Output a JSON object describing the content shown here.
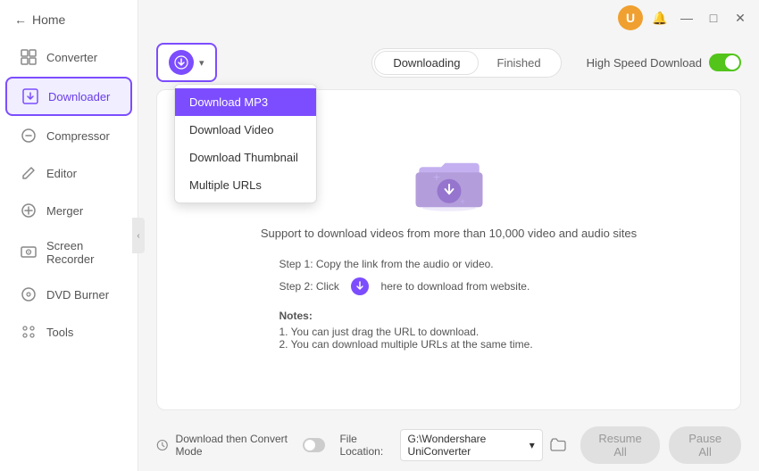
{
  "titlebar": {
    "user_icon": "👤",
    "bell_label": "🔔",
    "minimize_label": "—",
    "maximize_label": "□",
    "close_label": "✕"
  },
  "sidebar": {
    "back_label": "Home",
    "items": [
      {
        "id": "converter",
        "label": "Converter",
        "icon": "⧉",
        "active": false
      },
      {
        "id": "downloader",
        "label": "Downloader",
        "icon": "⬇",
        "active": true
      },
      {
        "id": "compressor",
        "label": "Compressor",
        "icon": "⊟",
        "active": false
      },
      {
        "id": "editor",
        "label": "Editor",
        "icon": "✂",
        "active": false
      },
      {
        "id": "merger",
        "label": "Merger",
        "icon": "⊕",
        "active": false
      },
      {
        "id": "screen-recorder",
        "label": "Screen Recorder",
        "icon": "◉",
        "active": false
      },
      {
        "id": "dvd-burner",
        "label": "DVD Burner",
        "icon": "💿",
        "active": false
      },
      {
        "id": "tools",
        "label": "Tools",
        "icon": "⚙",
        "active": false
      }
    ]
  },
  "toolbar": {
    "download_button_label": "Download",
    "dropdown_arrow": "▾",
    "dropdown_items": [
      {
        "id": "mp3",
        "label": "Download MP3",
        "selected": true
      },
      {
        "id": "video",
        "label": "Download Video",
        "selected": false
      },
      {
        "id": "thumbnail",
        "label": "Download Thumbnail",
        "selected": false
      },
      {
        "id": "multiple",
        "label": "Multiple URLs",
        "selected": false
      }
    ],
    "tabs": [
      {
        "id": "downloading",
        "label": "Downloading",
        "active": true
      },
      {
        "id": "finished",
        "label": "Finished",
        "active": false
      }
    ],
    "high_speed_label": "High Speed Download"
  },
  "content": {
    "support_text": "Support to download videos from more than 10,000 video and audio sites",
    "step1": "Step 1: Copy the link from the audio or video.",
    "step2_prefix": "Step 2: Click",
    "step2_suffix": "here to download from website.",
    "notes_title": "Notes:",
    "note1": "1. You can just drag the URL to download.",
    "note2": "2. You can download multiple URLs at the same time."
  },
  "bottom": {
    "convert_mode_label": "Download then Convert Mode",
    "file_location_label": "File Location:",
    "file_path": "G:\\Wondershare UniConverter",
    "resume_all_label": "Resume All",
    "pause_all_label": "Pause All"
  }
}
